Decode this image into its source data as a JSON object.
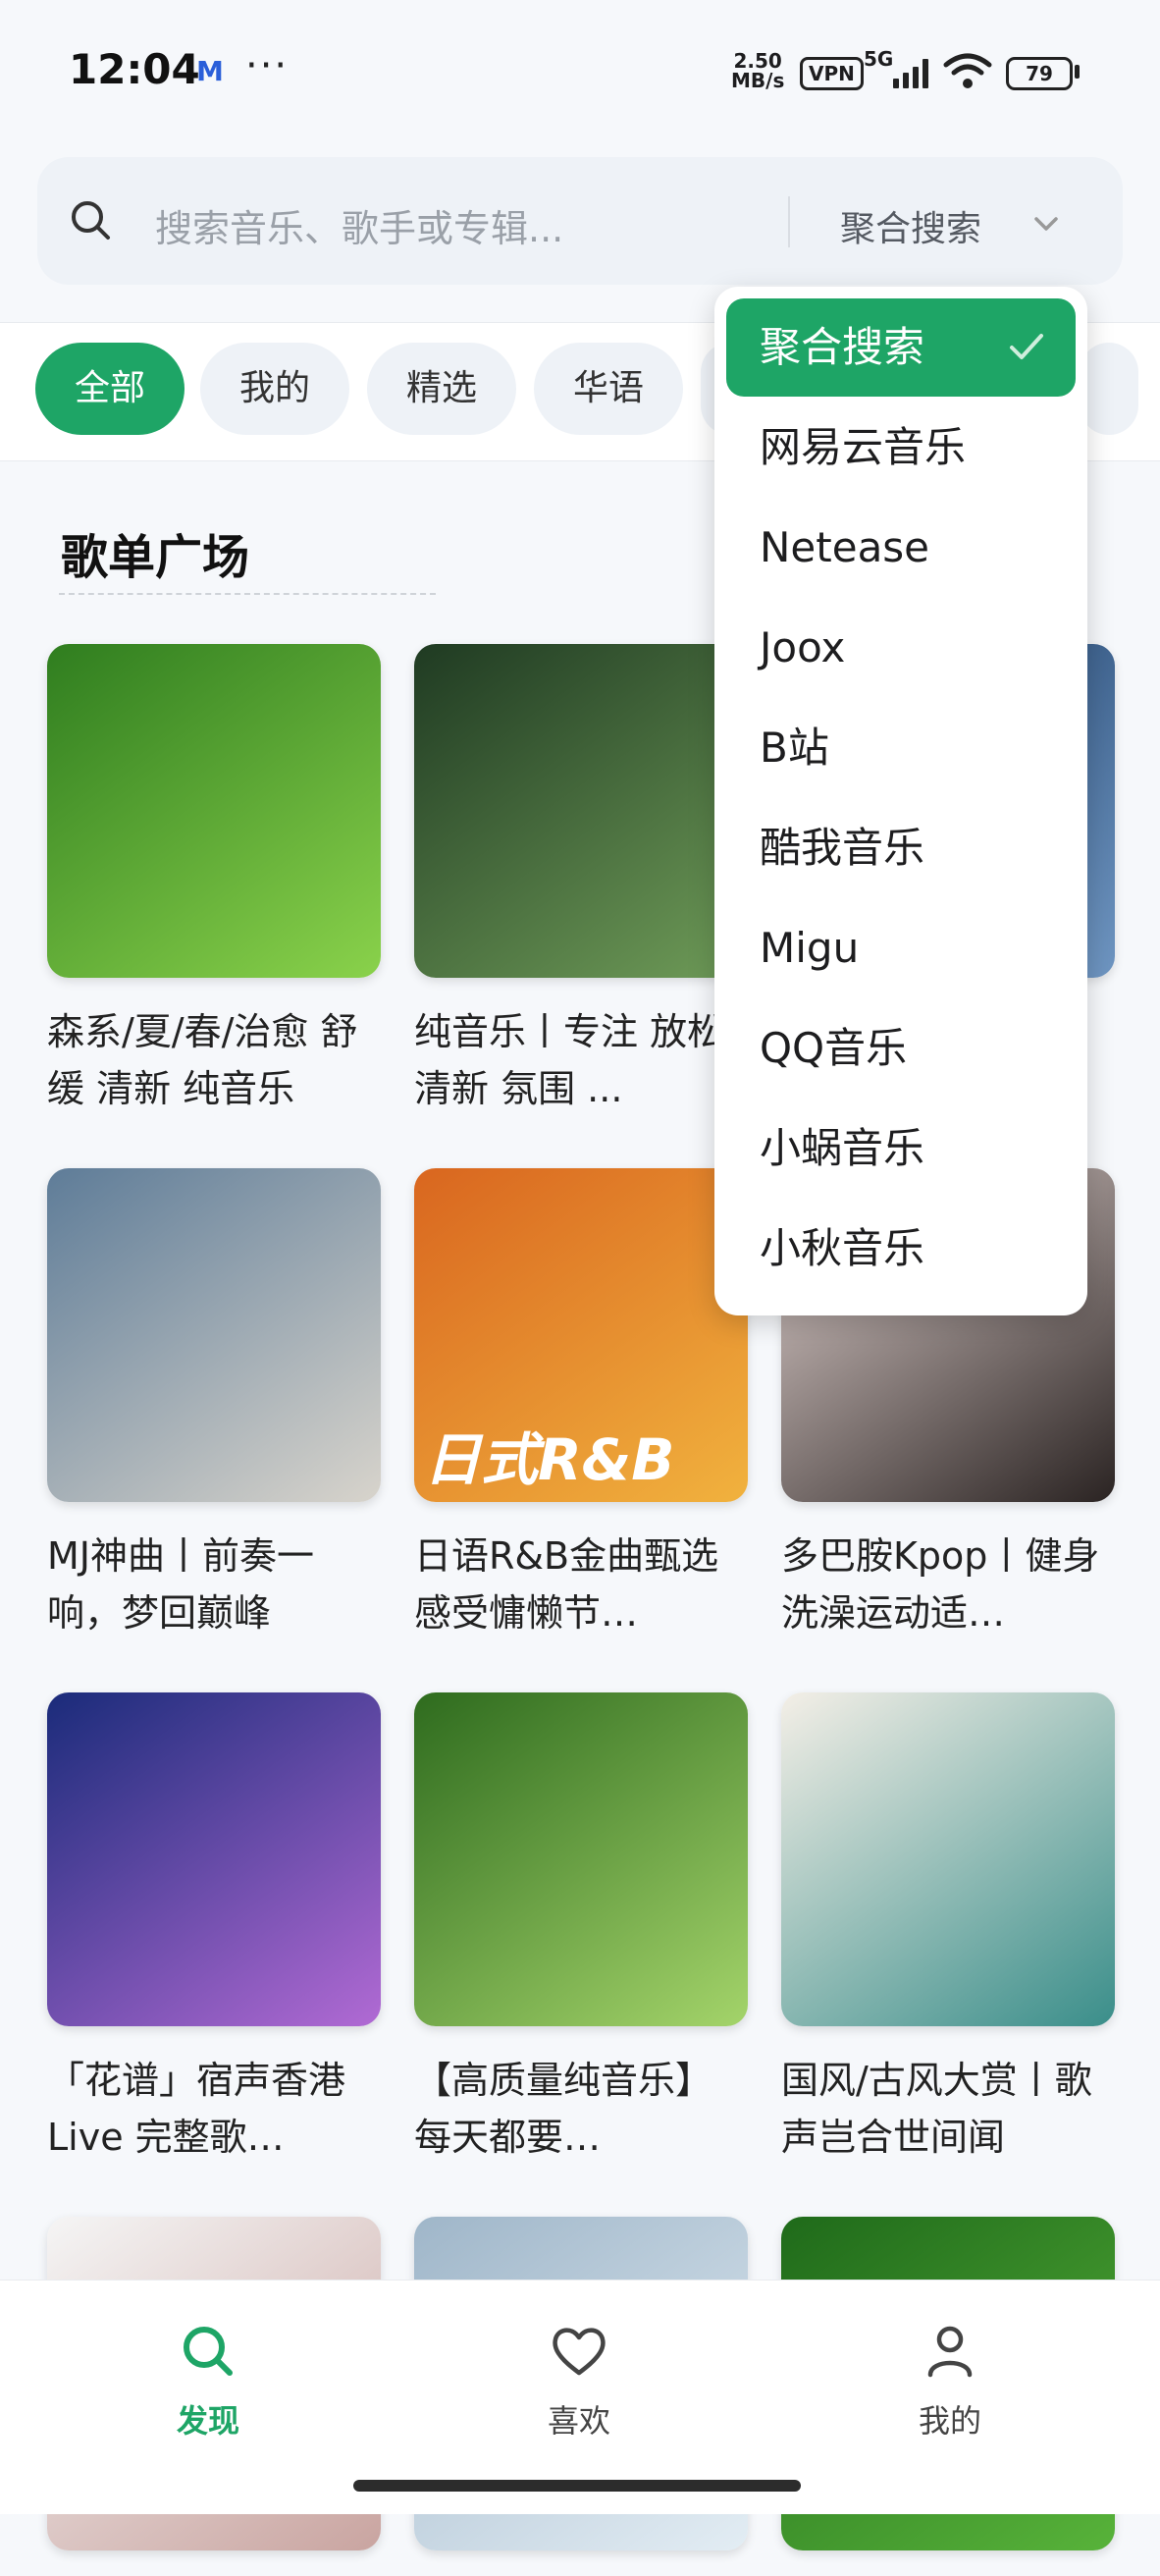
{
  "status_bar": {
    "time": "12:04",
    "carrier_icon": "M",
    "more": "···",
    "speed_value": "2.50",
    "speed_unit": "MB/s",
    "vpn": "VPN",
    "network": "5G",
    "battery": "79"
  },
  "search": {
    "placeholder": "搜索音乐、歌手或专辑...",
    "mode": "聚合搜索",
    "icon": "search-icon"
  },
  "filters": [
    "全部",
    "我的",
    "精选",
    "华语"
  ],
  "filters_active": 0,
  "section": {
    "title": "歌单广场"
  },
  "playlists": [
    {
      "title": "森系/夏/春/治愈 舒缓 清新 纯音乐",
      "colors": [
        "#2f7d1f",
        "#8ad24b"
      ]
    },
    {
      "title": "纯音乐丨专注 放松 清新 氛围 ...",
      "colors": [
        "#1f3a22",
        "#6f9c58"
      ]
    },
    {
      "title": "",
      "colors": [
        "#22446f",
        "#6f96c2"
      ]
    },
    {
      "title": "MJ神曲丨前奏一响，梦回巅峰",
      "colors": [
        "#5e7c98",
        "#d8d4cc"
      ]
    },
    {
      "title": "日语R&B金曲甄选 感受慵懒节…",
      "colors": [
        "#d9661f",
        "#f1b23e"
      ],
      "overlay": "日式R&B"
    },
    {
      "title": "多巴胺Kpop丨健身洗澡运动适…",
      "colors": [
        "#e7d8d5",
        "#2a2322"
      ]
    },
    {
      "title": "「花谱」宿声香港Live 完整歌…",
      "colors": [
        "#1a2b7a",
        "#b16ad4"
      ]
    },
    {
      "title": "【高质量纯音乐】每天都要…",
      "colors": [
        "#2e6b1e",
        "#a4d46a"
      ]
    },
    {
      "title": "国风/古风大赏丨歌声岂合世间闻",
      "colors": [
        "#f4efe7",
        "#3a8e8a"
      ]
    },
    {
      "title": "",
      "colors": [
        "#f5f5f5",
        "#c9a4a0"
      ]
    },
    {
      "title": "",
      "colors": [
        "#9fb6c9",
        "#e3edf4"
      ]
    },
    {
      "title": "",
      "colors": [
        "#1f6a1a",
        "#58b33a"
      ]
    }
  ],
  "dropdown": {
    "items": [
      "聚合搜索",
      "网易云音乐",
      "Netease",
      "Joox",
      "B站",
      "酷我音乐",
      "Migu",
      "QQ音乐",
      "小蜗音乐",
      "小秋音乐"
    ],
    "selected": 0
  },
  "bottom_nav": [
    {
      "label": "发现",
      "icon": "search-icon"
    },
    {
      "label": "喜欢",
      "icon": "heart-icon"
    },
    {
      "label": "我的",
      "icon": "person-icon"
    }
  ],
  "accent": "#1ea566"
}
